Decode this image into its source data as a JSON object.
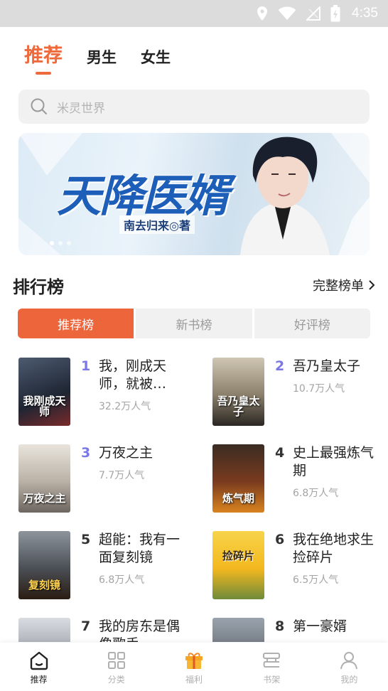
{
  "status_bar": {
    "time": "4:35"
  },
  "top_tabs": [
    {
      "label": "推荐",
      "active": true
    },
    {
      "label": "男生",
      "active": false
    },
    {
      "label": "女生",
      "active": false
    }
  ],
  "search": {
    "placeholder": "米灵世界"
  },
  "banner": {
    "title": "天降医婿",
    "author": "南去归来◎著"
  },
  "ranking": {
    "title": "排行榜",
    "more_label": "完整榜单",
    "tabs": [
      {
        "label": "推荐榜",
        "active": true
      },
      {
        "label": "新书榜",
        "active": false
      },
      {
        "label": "好评榜",
        "active": false
      }
    ],
    "books": [
      {
        "rank": "1",
        "name": "我，刚成天师，就被…",
        "popularity": "32.2万人气",
        "cover_text": "我刚成天师"
      },
      {
        "rank": "2",
        "name": "吾乃皇太子",
        "popularity": "10.7万人气",
        "cover_text": "吾乃皇太子"
      },
      {
        "rank": "3",
        "name": "万夜之主",
        "popularity": "7.7万人气",
        "cover_text": "万夜之主"
      },
      {
        "rank": "4",
        "name": "史上最强炼气期",
        "popularity": "6.8万人气",
        "cover_text": "炼气期"
      },
      {
        "rank": "5",
        "name": "超能：我有一面复刻镜",
        "popularity": "6.8万人气",
        "cover_text": "复刻镜"
      },
      {
        "rank": "6",
        "name": "我在绝地求生捡碎片",
        "popularity": "6.5万人气",
        "cover_text": "捡碎片"
      },
      {
        "rank": "7",
        "name": "我的房东是偶像歌手",
        "popularity": "",
        "cover_text": ""
      },
      {
        "rank": "8",
        "name": "第一豪婿",
        "popularity": "",
        "cover_text": ""
      }
    ]
  },
  "bottom_nav": [
    {
      "label": "推荐",
      "icon": "home-icon",
      "active": true
    },
    {
      "label": "分类",
      "icon": "grid-icon",
      "active": false
    },
    {
      "label": "福利",
      "icon": "gift-icon",
      "active": false
    },
    {
      "label": "书架",
      "icon": "bookshelf-icon",
      "active": false
    },
    {
      "label": "我的",
      "icon": "profile-icon",
      "active": false
    }
  ],
  "colors": {
    "accent": "#ed653a",
    "rank_highlight": "#7b77e6",
    "gift": "#f5a623"
  }
}
